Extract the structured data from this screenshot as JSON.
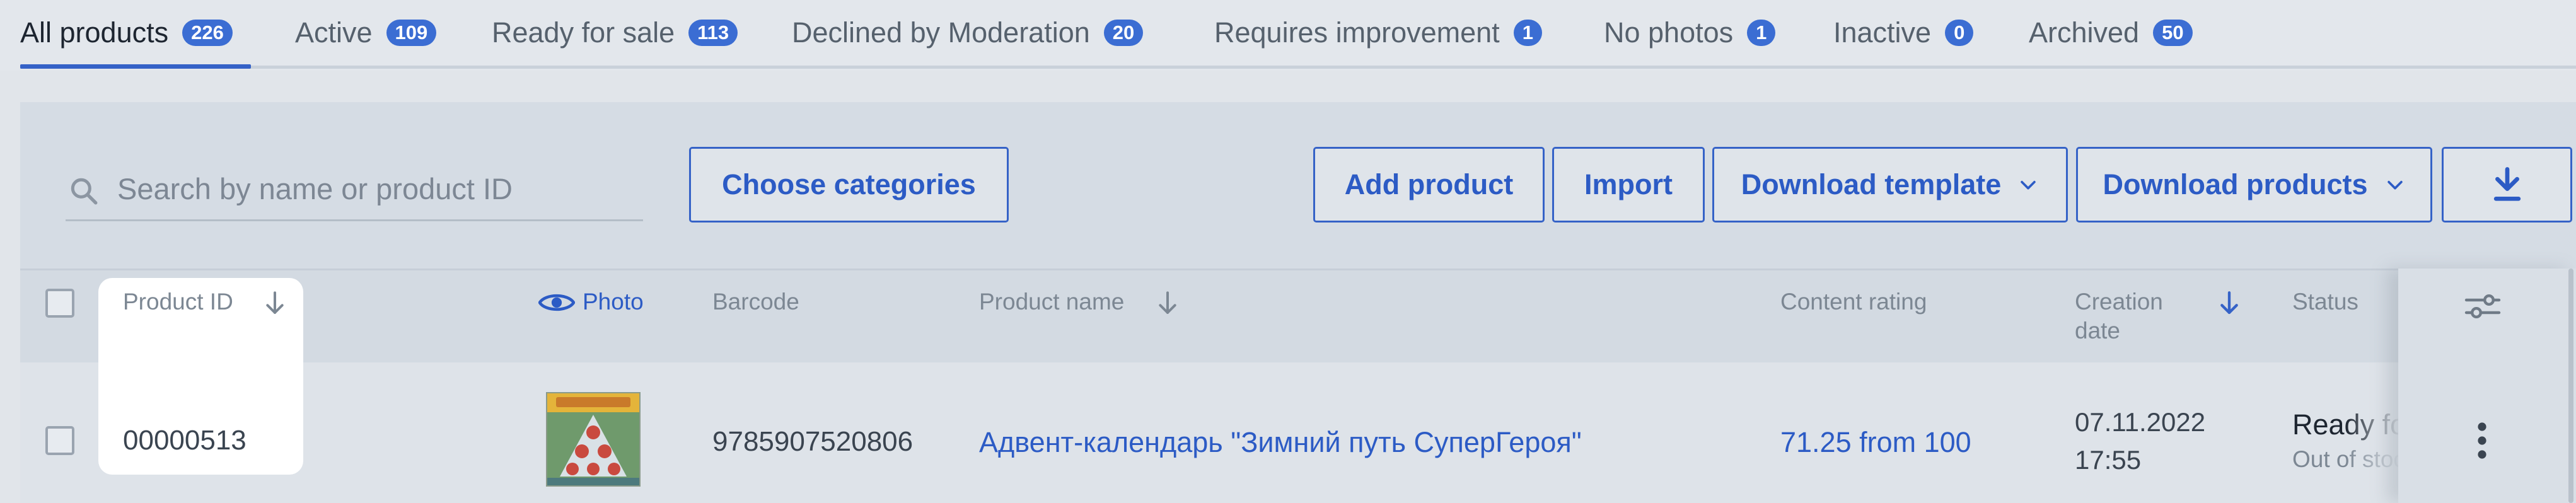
{
  "tabs": [
    {
      "label": "All products",
      "count": "226",
      "active": true
    },
    {
      "label": "Active",
      "count": "109"
    },
    {
      "label": "Ready for sale",
      "count": "113"
    },
    {
      "label": "Declined by Moderation",
      "count": "20"
    },
    {
      "label": "Requires improvement",
      "count": "1"
    },
    {
      "label": "No photos",
      "count": "1"
    },
    {
      "label": "Inactive",
      "count": "0"
    },
    {
      "label": "Archived",
      "count": "50"
    }
  ],
  "search": {
    "placeholder": "Search by name or product ID",
    "value": ""
  },
  "toolbar": {
    "choose_categories": "Choose categories",
    "add_product": "Add product",
    "import": "Import",
    "download_template": "Download template",
    "download_products": "Download products"
  },
  "table": {
    "columns": {
      "product_id": "Product ID",
      "photo": "Photo",
      "barcode": "Barcode",
      "product_name": "Product name",
      "content_rating": "Content rating",
      "creation_date_line1": "Creation",
      "creation_date_line2": "date",
      "status": "Status"
    },
    "rows": [
      {
        "product_id": "00000513",
        "barcode": "9785907520806",
        "product_name": "Адвент-календарь \"Зимний путь СуперГероя\"",
        "content_rating": "71.25 from 100",
        "creation_date": "07.11.2022",
        "creation_time": "17:55",
        "status": "Ready for sale",
        "status_sub": "Out of stock"
      }
    ]
  },
  "icons": {
    "search": "search-icon",
    "photo": "eye-icon",
    "sort": "arrow-down-icon",
    "chevron": "chevron-down-icon",
    "download": "download-icon",
    "settings": "sliders-icon",
    "more": "more-vertical-icon"
  },
  "colors": {
    "accent": "#3562c7",
    "badge": "#3b6dd3",
    "link": "#2c5bc5"
  }
}
